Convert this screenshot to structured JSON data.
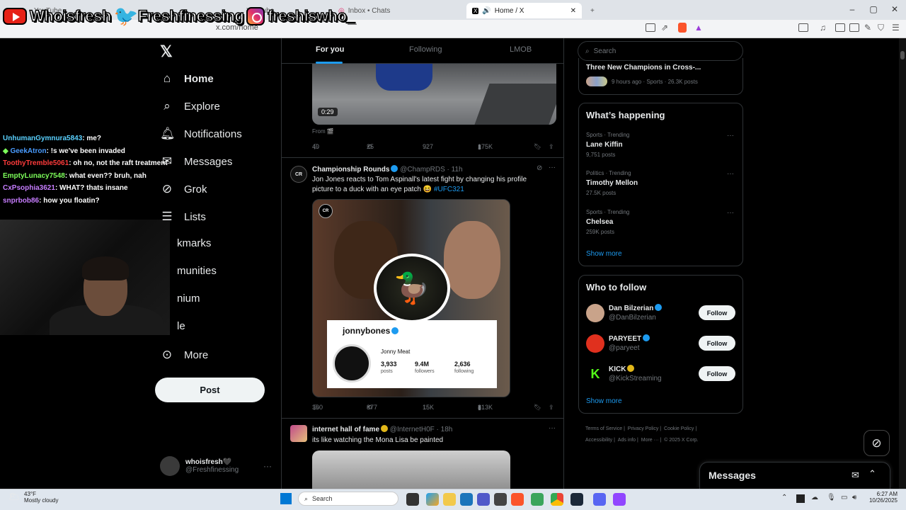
{
  "browser": {
    "tabs": [
      {
        "label": "YouTube"
      },
      {
        "label": "YouTube"
      },
      {
        "label": "Inbox • Chats"
      },
      {
        "label": "Home / X"
      }
    ],
    "new_tab": "+",
    "url": "x.com/home"
  },
  "overlay": {
    "youtube": "Whoisfresh",
    "twitter": "Freshfinessing",
    "instagram": "freshiswho_"
  },
  "chat": [
    {
      "user": "UnhumanGymnura5843",
      "msg": ": me?",
      "color": "#5ad1ff"
    },
    {
      "user": "GeekAtron",
      "msg": ": !s we've been invaded",
      "color": "#4a9cff"
    },
    {
      "user": "ToothyTremble5061",
      "msg": ": oh no, not the raft treatment",
      "color": "#ff3b3b"
    },
    {
      "user": "EmptyLunacy7548",
      "msg": ": what even?? bruh, nah",
      "color": "#7dff5a"
    },
    {
      "user": "CxPsophia3621",
      "msg": ": WHAT? thats insane",
      "color": "#c77dff"
    },
    {
      "user": "snprbob86",
      "msg": ": how you floatin?",
      "color": "#c77dff"
    }
  ],
  "nav": {
    "items": [
      {
        "label": "Home",
        "icon": "home-icon"
      },
      {
        "label": "Explore",
        "icon": "search-icon"
      },
      {
        "label": "Notifications",
        "icon": "bell-icon"
      },
      {
        "label": "Messages",
        "icon": "mail-icon"
      },
      {
        "label": "Grok",
        "icon": "grok-icon"
      },
      {
        "label": "Lists",
        "icon": "list-icon"
      },
      {
        "label": "kmarks",
        "icon": "bookmark-icon"
      },
      {
        "label": "munities",
        "icon": "communities-icon"
      },
      {
        "label": "nium",
        "icon": "premium-icon"
      },
      {
        "label": "le",
        "icon": "profile-icon"
      },
      {
        "label": "More",
        "icon": "more-icon"
      }
    ],
    "post_label": "Post",
    "profile_name": "whoisfresh🖤",
    "profile_handle": "@Freshfinessing"
  },
  "feed": {
    "tabs": [
      "For you",
      "Following",
      "LMOB"
    ],
    "tweet1": {
      "duration": "0:29",
      "from": "From 🎬",
      "replies": "40",
      "reposts": "25",
      "likes": "927",
      "views": "175K"
    },
    "tweet2": {
      "name": "Championship Rounds",
      "handle": "@ChampRDS",
      "time": "· 11h",
      "text": "Jon Jones reacts to Tom Aspinall's latest fight by changing his profile picture to a duck with an eye patch 😆",
      "hashtag": "#UFC321",
      "card": {
        "username": "jonnybones",
        "display": "Jonny Meat",
        "posts": "3,933",
        "posts_label": "posts",
        "followers": "9.4M",
        "followers_label": "followers",
        "following": "2,636",
        "following_label": "following"
      },
      "replies": "360",
      "reposts": "877",
      "likes": "15K",
      "views": "813K"
    },
    "tweet3": {
      "name": "internet hall of fame",
      "handle": "@InternetH0F",
      "time": "· 18h",
      "text": "its like watching the Mona Lisa be painted"
    }
  },
  "right": {
    "search_placeholder": "Search",
    "top_card": {
      "title": "Three New Champions in Cross-...",
      "meta": "9 hours ago · Sports · 26.3K posts"
    },
    "happening_title": "What’s happening",
    "trends": [
      {
        "meta": "Sports · Trending",
        "name": "Lane Kiffin",
        "posts": "9,751 posts"
      },
      {
        "meta": "Politics · Trending",
        "name": "Timothy Mellon",
        "posts": "27.5K posts"
      },
      {
        "meta": "Sports · Trending",
        "name": "Chelsea",
        "posts": "259K posts"
      }
    ],
    "show_more": "Show more",
    "wtf_title": "Who to follow",
    "follows": [
      {
        "name": "Dan Bilzerian",
        "handle": "@DanBilzerian",
        "color": "#c9a38a"
      },
      {
        "name": "PARYEET",
        "handle": "@paryeet",
        "color": "#e0301e"
      },
      {
        "name": "KICK",
        "handle": "@KickStreaming",
        "color": "#111"
      }
    ],
    "follow_label": "Follow",
    "footer": [
      "Terms of Service",
      "Privacy Policy",
      "Cookie Policy",
      "Accessibility",
      "Ads info",
      "More ···",
      "© 2025 X Corp."
    ],
    "messages_label": "Messages"
  },
  "taskbar": {
    "weather_temp": "43°F",
    "weather_desc": "Mostly cloudy",
    "search": "Search",
    "time": "6:27 AM",
    "date": "10/26/2025"
  }
}
